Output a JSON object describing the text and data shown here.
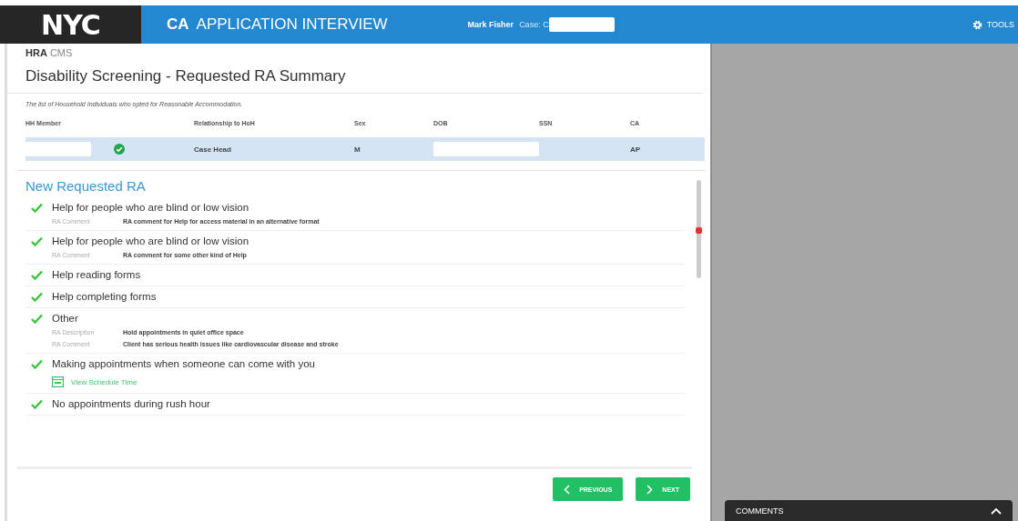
{
  "header": {
    "logo": "NYC",
    "app_code": "CA",
    "app_title": "APPLICATION INTERVIEW",
    "user": "Mark Fisher",
    "case_label": "Case: C",
    "tools": "TOOLS"
  },
  "brand": {
    "strong": "HRA",
    "rest": "CMS"
  },
  "page_title": "Disability Screening - Requested RA Summary",
  "intro": "The list of Household Individuals who opted for Reasonable Accommodation.",
  "table": {
    "columns": [
      "HH Member",
      "Relationship to HoH",
      "Sex",
      "DOB",
      "SSN",
      "CA"
    ],
    "rows": [
      {
        "selected": true,
        "member_verified": true,
        "relationship": "Case Head",
        "sex": "M",
        "ca": "AP"
      }
    ]
  },
  "section_title": "New Requested RA",
  "items": [
    {
      "title": "Help for people who are blind or low vision",
      "checked": true,
      "details": [
        {
          "label": "RA Comment",
          "value": "RA comment for Help for access material in an alternative format"
        }
      ]
    },
    {
      "title": "Help for people who are blind or low vision",
      "checked": true,
      "details": [
        {
          "label": "RA Comment",
          "value": "RA comment for some other kind of Help"
        }
      ]
    },
    {
      "title": "Help reading forms",
      "checked": true
    },
    {
      "title": "Help completing forms",
      "checked": true
    },
    {
      "title": "Other",
      "checked": true,
      "details": [
        {
          "label": "RA Description",
          "value": "Hold appointments in quiet office space"
        },
        {
          "label": "RA Comment",
          "value": "Client has serious health issues like cardiovascular disease and stroke"
        }
      ]
    },
    {
      "title": "Making appointments when someone can come with you",
      "checked": true,
      "link": "View Schedule Time"
    },
    {
      "title": "No appointments during rush hour",
      "checked": true
    }
  ],
  "buttons": {
    "previous": "PREVIOUS",
    "next": "NEXT"
  },
  "comments": {
    "title": "COMMENTS",
    "expanded": false
  }
}
